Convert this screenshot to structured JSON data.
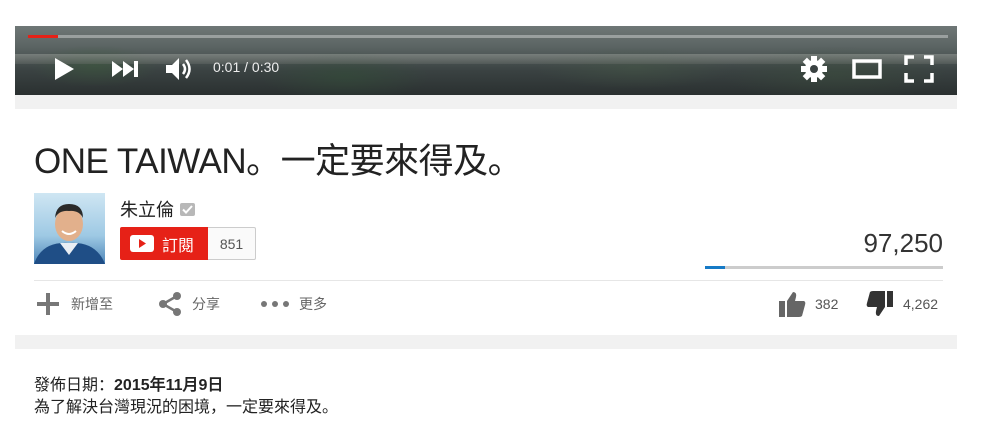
{
  "player": {
    "current_time": "0:01",
    "duration": "0:30",
    "time_separator": " / ",
    "progress": 0.033,
    "icons": [
      "play-icon",
      "next-icon",
      "volume-icon",
      "settings-icon",
      "theater-mode-icon",
      "fullscreen-icon"
    ],
    "accent_color": "#e62117"
  },
  "video": {
    "title": "ONE TAIWAN。一定要來得及。"
  },
  "channel": {
    "name": "朱立倫",
    "subscribe_label": "訂閱",
    "subscriber_count": "851"
  },
  "stats": {
    "views": "97,250",
    "like_ratio": 0.082,
    "likes": "382",
    "dislikes": "4,262"
  },
  "actions": {
    "add_to": "新增至",
    "share": "分享",
    "more": "更多"
  },
  "description": {
    "published_label": "發佈日期：",
    "published_date": "2015年11月9日",
    "text": "為了解決台灣現況的困境，一定要來得及。"
  }
}
